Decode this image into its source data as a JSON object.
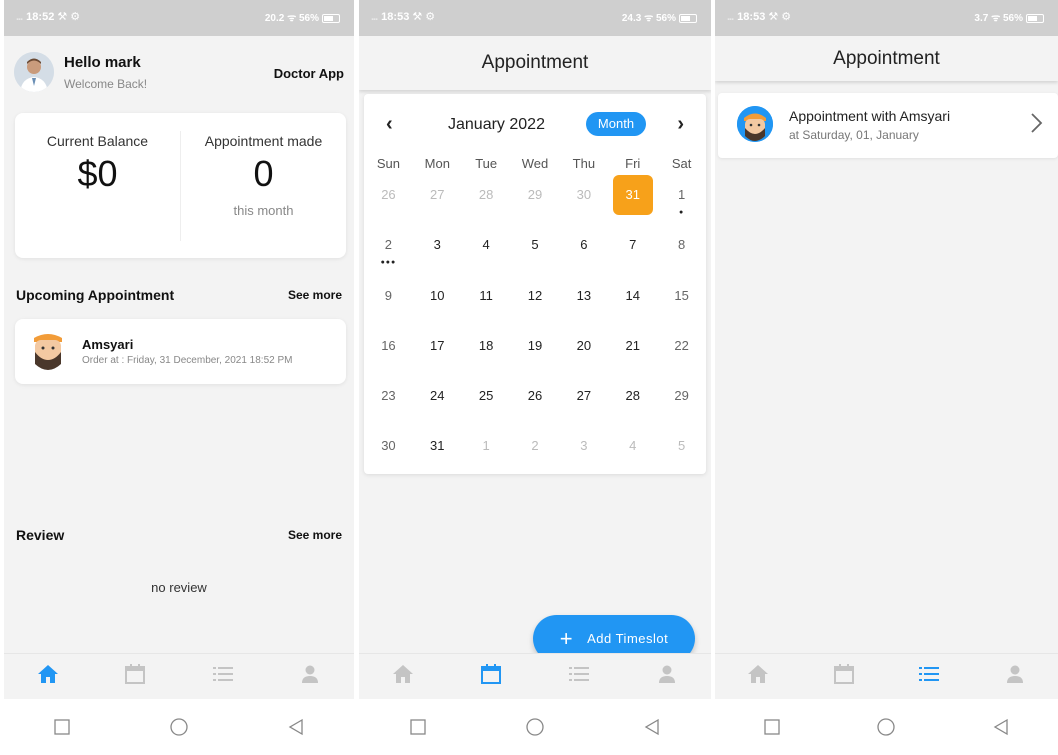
{
  "colors": {
    "accent": "#2196f3",
    "selected_day": "#f7a11a",
    "nav_inactive": "#c4c4c4"
  },
  "status_bars": [
    {
      "time": "18:52",
      "signal": "...",
      "tools": "⚒ ⚙",
      "speed": "20.2",
      "speed_unit": "KB/S",
      "battery": "56%"
    },
    {
      "time": "18:53",
      "signal": "...",
      "tools": "⚒ ⚙",
      "speed": "24.3",
      "speed_unit": "KB/S",
      "battery": "56%"
    },
    {
      "time": "18:53",
      "signal": "...",
      "tools": "⚒ ⚙",
      "speed": "3.7",
      "speed_unit": "KB/S",
      "battery": "56%"
    }
  ],
  "home": {
    "greeting": "Hello mark",
    "welcome": "Welcome Back!",
    "app_name": "Doctor App",
    "balance_label": "Current Balance",
    "balance_value": "$0",
    "appointments_label": "Appointment made",
    "appointments_value": "0",
    "appointments_period": "this month",
    "upcoming_title": "Upcoming Appointment",
    "upcoming_more": "See more",
    "upcoming_items": [
      {
        "name": "Amsyari",
        "order": "Order at : Friday, 31 December, 2021 18:52 PM"
      }
    ],
    "review_title": "Review",
    "review_more": "See more",
    "review_empty": "no review"
  },
  "calendar": {
    "title": "Appointment",
    "month_title": "January 2022",
    "format_button": "Month",
    "weekdays": [
      "Sun",
      "Mon",
      "Tue",
      "Wed",
      "Thu",
      "Fri",
      "Sat"
    ],
    "weeks": [
      [
        {
          "d": "26",
          "out": true
        },
        {
          "d": "27",
          "out": true
        },
        {
          "d": "28",
          "out": true
        },
        {
          "d": "29",
          "out": true
        },
        {
          "d": "30",
          "out": true
        },
        {
          "d": "31",
          "out": true,
          "selected": true
        },
        {
          "d": "1",
          "markers": 1
        }
      ],
      [
        {
          "d": "2",
          "markers": 3
        },
        {
          "d": "3"
        },
        {
          "d": "4"
        },
        {
          "d": "5"
        },
        {
          "d": "6"
        },
        {
          "d": "7"
        },
        {
          "d": "8"
        }
      ],
      [
        {
          "d": "9"
        },
        {
          "d": "10"
        },
        {
          "d": "11"
        },
        {
          "d": "12"
        },
        {
          "d": "13"
        },
        {
          "d": "14"
        },
        {
          "d": "15"
        }
      ],
      [
        {
          "d": "16"
        },
        {
          "d": "17"
        },
        {
          "d": "18"
        },
        {
          "d": "19"
        },
        {
          "d": "20"
        },
        {
          "d": "21"
        },
        {
          "d": "22"
        }
      ],
      [
        {
          "d": "23"
        },
        {
          "d": "24"
        },
        {
          "d": "25"
        },
        {
          "d": "26"
        },
        {
          "d": "27"
        },
        {
          "d": "28"
        },
        {
          "d": "29"
        }
      ],
      [
        {
          "d": "30"
        },
        {
          "d": "31"
        },
        {
          "d": "1",
          "out": true
        },
        {
          "d": "2",
          "out": true
        },
        {
          "d": "3",
          "out": true
        },
        {
          "d": "4",
          "out": true
        },
        {
          "d": "5",
          "out": true
        }
      ]
    ],
    "fab_label": "Add Timeslot"
  },
  "appointments": {
    "title": "Appointment",
    "items": [
      {
        "title": "Appointment with Amsyari",
        "subtitle": "at Saturday, 01, January"
      }
    ]
  },
  "nav": {
    "items": [
      {
        "name": "home-nav",
        "icon": "home-icon"
      },
      {
        "name": "calendar-nav",
        "icon": "calendar-icon"
      },
      {
        "name": "list-nav",
        "icon": "list-icon"
      },
      {
        "name": "profile-nav",
        "icon": "person-icon"
      }
    ],
    "active_by_screen": [
      "home-icon",
      "calendar-icon",
      "list-icon"
    ]
  }
}
